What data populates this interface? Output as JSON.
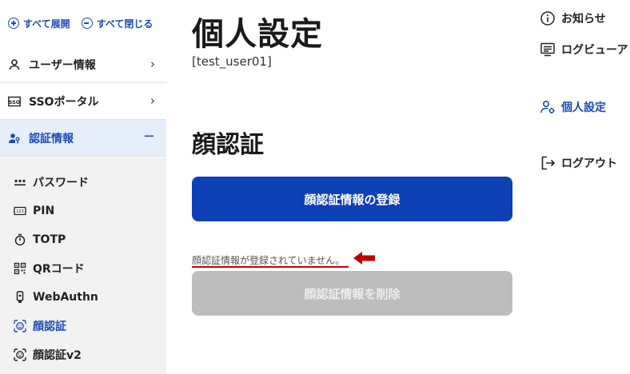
{
  "sidebar": {
    "expand_all": "すべて展開",
    "collapse_all": "すべて閉じる",
    "sections": [
      {
        "label": "ユーザー情報",
        "icon": "user-icon",
        "indicator": "›"
      },
      {
        "label": "SSOポータル",
        "icon": "sso-icon",
        "indicator": "›"
      },
      {
        "label": "認証情報",
        "icon": "user-key-icon",
        "indicator": "−"
      }
    ],
    "sub_items": [
      {
        "label": "パスワード",
        "icon": "password-dots-icon"
      },
      {
        "label": "PIN",
        "icon": "pin-pad-icon"
      },
      {
        "label": "TOTP",
        "icon": "stopwatch-icon"
      },
      {
        "label": "QRコード",
        "icon": "qr-code-icon"
      },
      {
        "label": "WebAuthn",
        "icon": "security-key-icon"
      },
      {
        "label": "顔認証",
        "icon": "face-scan-icon"
      },
      {
        "label": "顔認証v2",
        "icon": "face-scan-v2-icon"
      }
    ]
  },
  "main": {
    "page_title": "個人設定",
    "user_id": "[test_user01]",
    "section_title": "顔認証",
    "register_button": "顔認証情報の登録",
    "status_message": "顔認証情報が登録されていません。",
    "delete_button": "顔認証情報を削除"
  },
  "right_menu": {
    "items": [
      {
        "label": "お知らせ",
        "icon": "info-icon"
      },
      {
        "label": "ログビューア",
        "icon": "log-viewer-icon"
      },
      {
        "label": "個人設定",
        "icon": "user-settings-icon"
      },
      {
        "label": "ログアウト",
        "icon": "logout-icon"
      }
    ]
  },
  "colors": {
    "accent": "#0e40b6",
    "active_bg": "#e6eef9",
    "disabled_button": "#bdbdbd",
    "annotation_red": "#c00000"
  }
}
